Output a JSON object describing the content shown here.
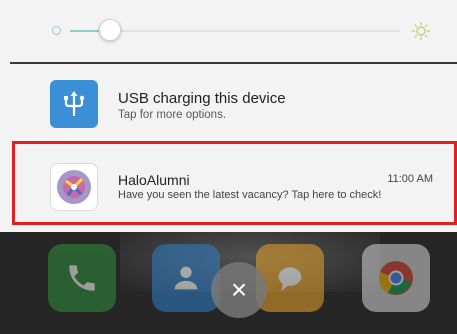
{
  "brightness": {
    "level_percent": 12,
    "dim_icon": "brightness-low-icon",
    "bright_icon": "brightness-high-icon"
  },
  "notifications": [
    {
      "icon": "usb-icon",
      "title": "USB charging this device",
      "subtitle": "Tap for more options."
    },
    {
      "icon": "haloalumni-app-icon",
      "app_name": "HaloAlumni",
      "time": "11:00 AM",
      "message": "Have you seen the latest vacancy? Tap here to check!"
    }
  ],
  "dock": {
    "apps": [
      "phone-icon",
      "contacts-icon",
      "messages-icon",
      "chrome-icon"
    ]
  },
  "close_button": {
    "glyph": "×"
  },
  "colors": {
    "usb_icon_bg": "#3a8fd7",
    "highlight_border": "#e02020",
    "slider_fill": "#8fcfc9"
  }
}
